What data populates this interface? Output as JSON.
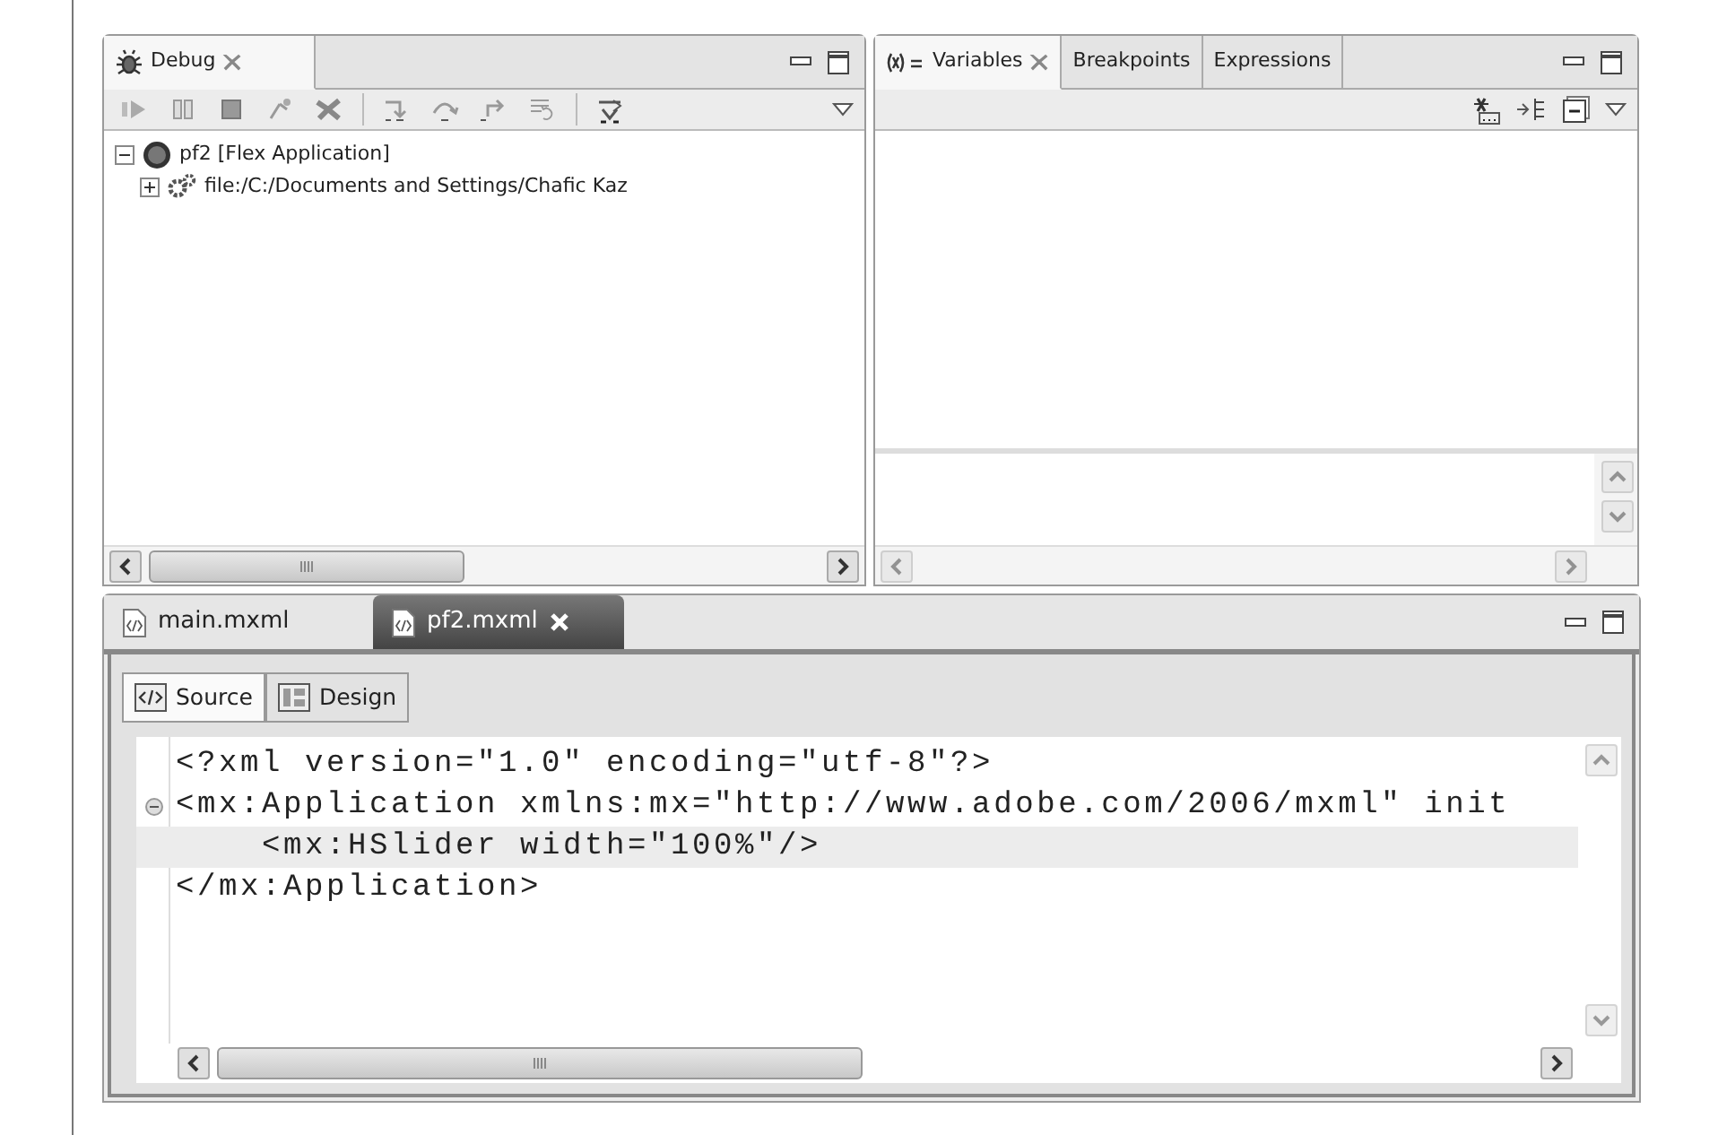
{
  "debug_view": {
    "tab": {
      "label": "Debug",
      "selected": true
    },
    "tree": [
      {
        "label": "pf2 [Flex Application]",
        "expanded": true,
        "children": [
          {
            "label": "file:/C:/Documents and Settings/Chafic Kaz",
            "expanded": false
          }
        ]
      }
    ]
  },
  "variables_view": {
    "tabs": [
      {
        "label": "Variables",
        "selected": true
      },
      {
        "label": "Breakpoints",
        "selected": false
      },
      {
        "label": "Expressions",
        "selected": false
      }
    ]
  },
  "editor": {
    "tabs": [
      {
        "label": "main.mxml",
        "selected": false
      },
      {
        "label": "pf2.mxml",
        "selected": true
      }
    ],
    "mode_tabs": [
      {
        "label": "Source",
        "selected": true
      },
      {
        "label": "Design",
        "selected": false
      }
    ],
    "lines": [
      {
        "text": "<?xml version=\"1.0\" encoding=\"utf-8\"?>",
        "foldable": false,
        "current": false
      },
      {
        "text": "<mx:Application xmlns:mx=\"http://www.adobe.com/2006/mxml\" init",
        "foldable": true,
        "current": false
      },
      {
        "text": "    <mx:HSlider width=\"100%\"/>",
        "foldable": false,
        "current": true
      },
      {
        "text": "</mx:Application>",
        "foldable": false,
        "current": false
      }
    ]
  }
}
